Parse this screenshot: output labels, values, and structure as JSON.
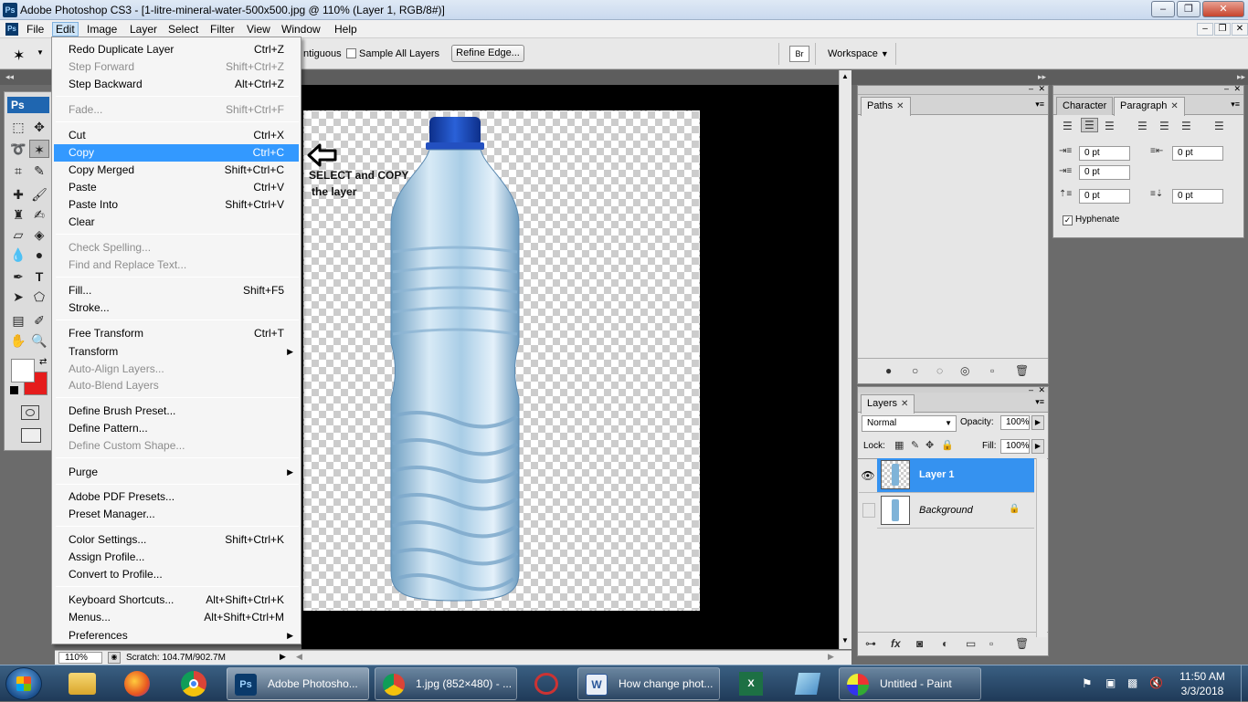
{
  "window": {
    "title": "Adobe Photoshop CS3 - [1-litre-mineral-water-500x500.jpg @ 110% (Layer 1, RGB/8#)]"
  },
  "menubar": [
    "File",
    "Edit",
    "Image",
    "Layer",
    "Select",
    "Filter",
    "View",
    "Window",
    "Help"
  ],
  "options": {
    "contiguous": "ntiguous",
    "sample_all": "Sample All Layers",
    "refine": "Refine Edge...",
    "workspace": "Workspace"
  },
  "edit_menu": {
    "items": [
      {
        "label": "Redo Duplicate Layer",
        "shortcut": "Ctrl+Z"
      },
      {
        "label": "Step Forward",
        "shortcut": "Shift+Ctrl+Z"
      },
      {
        "label": "Step Backward",
        "shortcut": "Alt+Ctrl+Z"
      },
      {
        "label": "Fade...",
        "shortcut": "Shift+Ctrl+F"
      },
      {
        "label": "Cut",
        "shortcut": "Ctrl+X"
      },
      {
        "label": "Copy",
        "shortcut": "Ctrl+C"
      },
      {
        "label": "Copy Merged",
        "shortcut": "Shift+Ctrl+C"
      },
      {
        "label": "Paste",
        "shortcut": "Ctrl+V"
      },
      {
        "label": "Paste Into",
        "shortcut": "Shift+Ctrl+V"
      },
      {
        "label": "Clear",
        "shortcut": ""
      },
      {
        "label": "Check Spelling...",
        "shortcut": ""
      },
      {
        "label": "Find and Replace Text...",
        "shortcut": ""
      },
      {
        "label": "Fill...",
        "shortcut": "Shift+F5"
      },
      {
        "label": "Stroke...",
        "shortcut": ""
      },
      {
        "label": "Free Transform",
        "shortcut": "Ctrl+T"
      },
      {
        "label": "Transform",
        "shortcut": ""
      },
      {
        "label": "Auto-Align Layers...",
        "shortcut": ""
      },
      {
        "label": "Auto-Blend Layers",
        "shortcut": ""
      },
      {
        "label": "Define Brush Preset...",
        "shortcut": ""
      },
      {
        "label": "Define Pattern...",
        "shortcut": ""
      },
      {
        "label": "Define Custom Shape...",
        "shortcut": ""
      },
      {
        "label": "Purge",
        "shortcut": ""
      },
      {
        "label": "Adobe PDF Presets...",
        "shortcut": ""
      },
      {
        "label": "Preset Manager...",
        "shortcut": ""
      },
      {
        "label": "Color Settings...",
        "shortcut": "Shift+Ctrl+K"
      },
      {
        "label": "Assign Profile...",
        "shortcut": ""
      },
      {
        "label": "Convert to Profile...",
        "shortcut": ""
      },
      {
        "label": "Keyboard Shortcuts...",
        "shortcut": "Alt+Shift+Ctrl+K"
      },
      {
        "label": "Menus...",
        "shortcut": "Alt+Shift+Ctrl+M"
      },
      {
        "label": "Preferences",
        "shortcut": ""
      }
    ]
  },
  "annotation": {
    "line1": "SELECT and COPY",
    "line2": "the layer"
  },
  "statusbar": {
    "zoom": "110%",
    "scratch": "Scratch: 104.7M/902.7M"
  },
  "paths_panel": {
    "tab": "Paths"
  },
  "char_panel": {
    "tab_character": "Character",
    "tab_paragraph": "Paragraph",
    "indent_left": "0 pt",
    "indent_right": "0 pt",
    "indent_first": "0 pt",
    "space_before": "0 pt",
    "space_after": "0 pt",
    "hyphenate": "Hyphenate"
  },
  "layers_panel": {
    "tab": "Layers",
    "blend_mode": "Normal",
    "opacity_label": "Opacity:",
    "opacity": "100%",
    "lock_label": "Lock:",
    "fill_label": "Fill:",
    "fill": "100%",
    "layers": [
      "Layer 1",
      "Background"
    ]
  },
  "taskbar": {
    "items": [
      "Adobe Photosho...",
      "1.jpg (852×480) - ...",
      "How change phot...",
      "Untitled - Paint"
    ],
    "time": "11:50 AM",
    "date": "3/3/2018"
  },
  "colors": {
    "accent": "#3399ff",
    "foreground": "#ffffff",
    "background": "#e51c1c"
  }
}
